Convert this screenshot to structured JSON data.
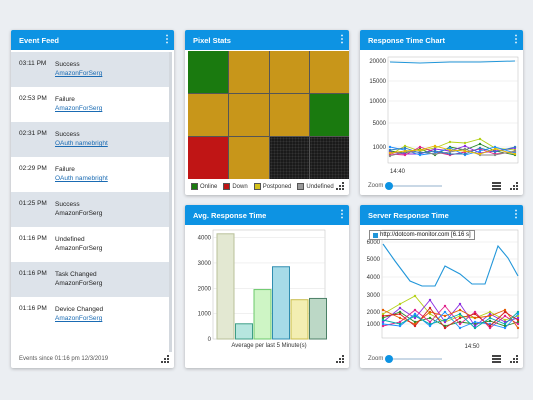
{
  "event_feed": {
    "title": "Event Feed",
    "events": [
      {
        "time": "03:11 PM",
        "status": "Success",
        "device": "AmazonForSerg",
        "link": true
      },
      {
        "time": "02:53 PM",
        "status": "Failure",
        "device": "AmazonForSerg",
        "link": true
      },
      {
        "time": "02:31 PM",
        "status": "Success",
        "device": "OAuth namebright",
        "link": true
      },
      {
        "time": "02:29 PM",
        "status": "Failure",
        "device": "OAuth namebright",
        "link": true
      },
      {
        "time": "01:25 PM",
        "status": "Success",
        "device": "AmazonForSerg",
        "link": false
      },
      {
        "time": "01:16 PM",
        "status": "Undefined",
        "device": "AmazonForSerg",
        "link": false
      },
      {
        "time": "01:16 PM",
        "status": "Task Changed",
        "device": "AmazonForSerg",
        "link": false
      },
      {
        "time": "01:16 PM",
        "status": "Device Changed",
        "device": "AmazonForSerg",
        "link": true
      }
    ],
    "footer": "Events since 01:16 pm 12/3/2019"
  },
  "pixel_stats": {
    "title": "Pixel Stats",
    "cells": [
      "online",
      "postponed",
      "postponed",
      "postponed",
      "postponed",
      "postponed",
      "postponed",
      "online",
      "down",
      "postponed",
      "undefined",
      "undefined"
    ],
    "legend": [
      {
        "label": "Online",
        "color": "#1a7a0f"
      },
      {
        "label": "Down",
        "color": "#c01515"
      },
      {
        "label": "Postponed",
        "color": "#d4c21c"
      },
      {
        "label": "Undefined",
        "color": "#9a9a9a"
      }
    ]
  },
  "response_time_chart": {
    "title": "Response Time Chart",
    "zoom_label": "Zoom",
    "chart_data": {
      "type": "line",
      "y_ticks": [
        "20000",
        "15000",
        "10000",
        "5000",
        "1000"
      ],
      "x_ticks": [
        "14:40"
      ]
    }
  },
  "avg_response_time": {
    "title": "Avg. Response Time",
    "chart_data": {
      "type": "bar",
      "xlabel": "Average per last 5 Minute(s)",
      "ylim": [
        0,
        4300
      ],
      "y_ticks": [
        "4000",
        "3000",
        "2000",
        "1000",
        "0"
      ],
      "values": [
        4150,
        600,
        1950,
        2850,
        1550,
        1600
      ],
      "fills": [
        "#e3e8d2",
        "#b6e6df",
        "#cef5c5",
        "#a6dbe8",
        "#f3eeb2",
        "#bcd8c6"
      ],
      "strokes": [
        "#b9c09a",
        "#3d9e86",
        "#6bc96b",
        "#2f8db0",
        "#c9bd4c",
        "#4b7f66"
      ]
    }
  },
  "server_response_time": {
    "title": "Server Response Time",
    "zoom_label": "Zoom",
    "tooltip": "http://dotcom-monitor.com [6.16 s]",
    "chart_data": {
      "type": "line",
      "y_ticks": [
        "6000",
        "5000",
        "4000",
        "3000",
        "2000",
        "1000"
      ],
      "x_ticks": [
        "14:50"
      ]
    }
  }
}
